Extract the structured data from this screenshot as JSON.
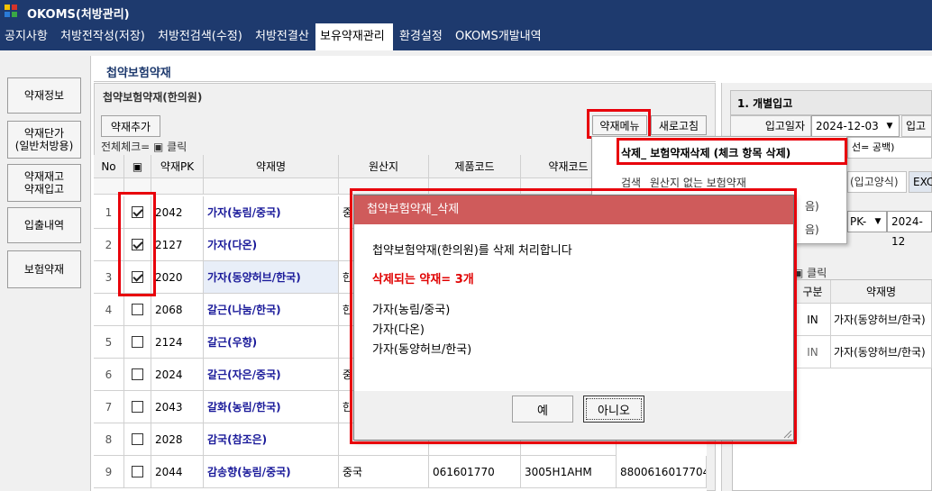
{
  "app": {
    "title": "OKOMS(처방관리)"
  },
  "menu_tabs": [
    "공지사항",
    "처방전작성(저장)",
    "처방전검색(수정)",
    "처방전결산",
    "보유약재관리",
    "환경설정",
    "OKOMS개발내역"
  ],
  "sidebar": [
    "약재정보",
    "약재단가\n(일반처방용)",
    "약재재고\n약재입고",
    "입출내역",
    "보험약재"
  ],
  "page": {
    "section_title": "첩약보험약재",
    "group_title": "첩약보험약재(한의원)"
  },
  "toolbar": {
    "add": "약재추가",
    "menu": "약재메뉴",
    "refresh": "새로고침",
    "check_all": "전체체크= ▣ 클릭"
  },
  "table": {
    "headers": [
      "No",
      "▣",
      "약재PK",
      "약재명",
      "원산지",
      "제품코드",
      "약재코드"
    ],
    "rows": [
      {
        "no": "1",
        "checked": true,
        "pk": "2042",
        "name": "가자(농림/중국)",
        "origin": "중",
        "code": "",
        "code2": ""
      },
      {
        "no": "2",
        "checked": true,
        "pk": "2127",
        "name": "가자(다온)",
        "origin": "",
        "code": "",
        "code2": ""
      },
      {
        "no": "3",
        "checked": true,
        "pk": "2020",
        "name": "가자(동양허브/한국)",
        "origin": "한",
        "code": "",
        "code2": ""
      },
      {
        "no": "4",
        "checked": false,
        "pk": "2068",
        "name": "갈근(나눔/한국)",
        "origin": "한",
        "code": "",
        "code2": ""
      },
      {
        "no": "5",
        "checked": false,
        "pk": "2124",
        "name": "갈근(우향)",
        "origin": "",
        "code": "",
        "code2": ""
      },
      {
        "no": "6",
        "checked": false,
        "pk": "2024",
        "name": "갈근(자은/중국)",
        "origin": "중",
        "code": "",
        "code2": ""
      },
      {
        "no": "7",
        "checked": false,
        "pk": "2043",
        "name": "갈화(농림/한국)",
        "origin": "한",
        "code": "",
        "code2": ""
      },
      {
        "no": "8",
        "checked": false,
        "pk": "2028",
        "name": "감국(참조은)",
        "origin": "",
        "code": "",
        "code2": ""
      },
      {
        "no": "9",
        "checked": false,
        "pk": "2044",
        "name": "감송향(농림/중국)",
        "origin": "중국",
        "code": "061601770",
        "code2": "3005H1AHM",
        "code3": "8800616017704"
      }
    ]
  },
  "right_panel": {
    "title": "1. 개별입고",
    "date_label": "입고일자",
    "date_value": "2024-12-03",
    "date_label2": "입고",
    "hint": "선= 공백)",
    "tab1": "(입고양식)",
    "tab2": "EXC",
    "pk_label": "PK-",
    "date2": "2024-12",
    "check_hint": "▣ 클릭",
    "grid_headers": [
      "구분",
      "약재명"
    ],
    "grid_rows": [
      {
        "type": "IN",
        "name": "가자(동양허브/한국)"
      },
      {
        "type": "IN",
        "name": "가자(동양허브/한국)"
      }
    ]
  },
  "context_menu": {
    "items": [
      "삭제_ 보험약재삭제 (체크 항목 삭제)",
      "검색_ 원산지 없는 보험약재",
      "음)",
      "음)"
    ]
  },
  "dialog": {
    "title": "첩약보험약재_삭제",
    "message": "첩약보험약재(한의원)를 삭제 처리합니다",
    "count_text": "삭제되는 약재= 3개",
    "items": [
      "가자(농림/중국)",
      "가자(다온)",
      "가자(동양허브/한국)"
    ],
    "yes": "예",
    "no": "아니오"
  },
  "colors": {
    "menubar": "#1e3a6e",
    "dialog_title": "#cf5b5b",
    "highlight": "#e8000b",
    "name_text": "#1a1a9a"
  }
}
